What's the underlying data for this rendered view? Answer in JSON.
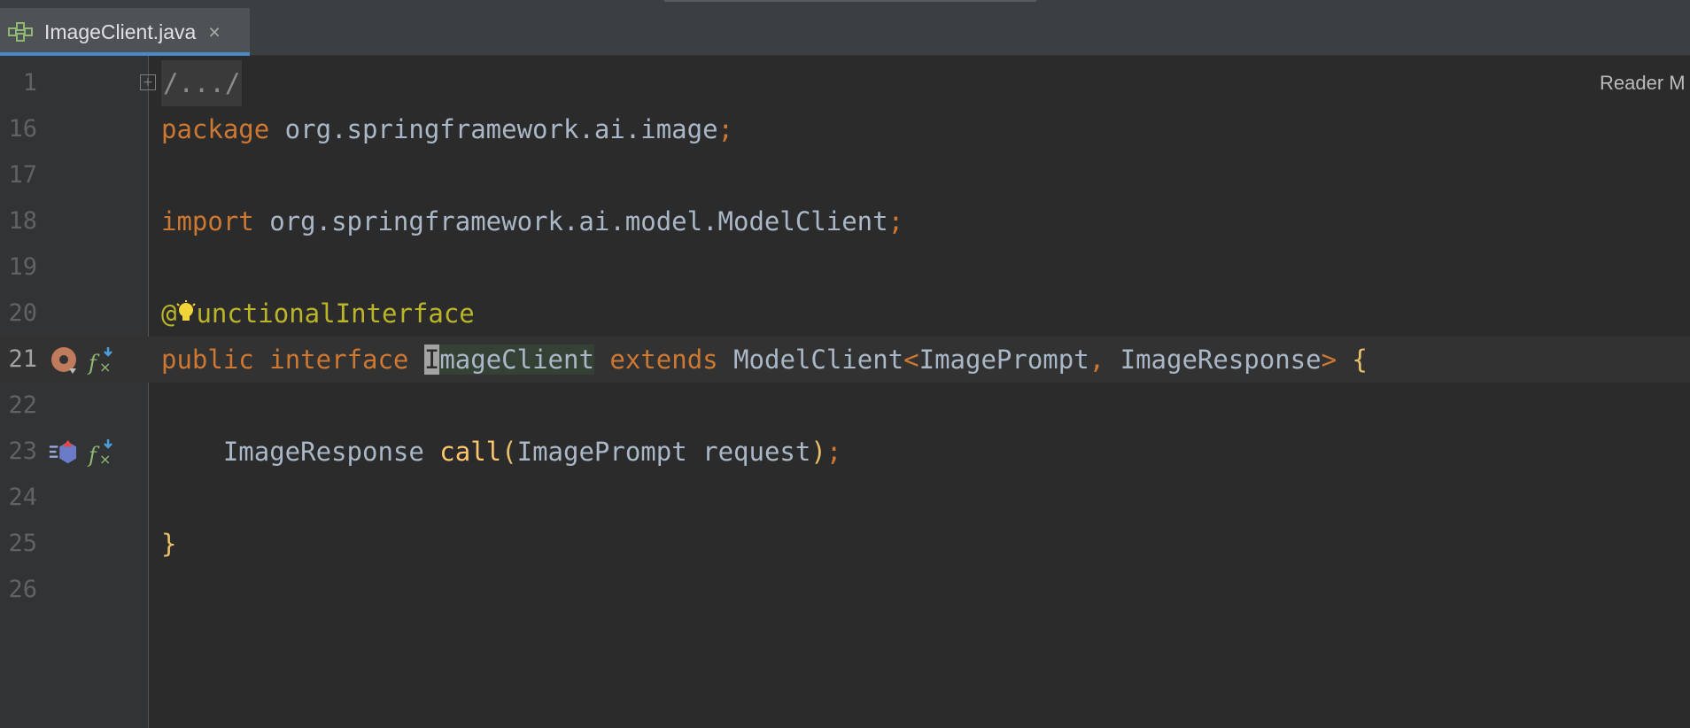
{
  "window": {
    "tab": {
      "label": "ImageClient.java",
      "icon": "interface-file-icon",
      "close": "×"
    }
  },
  "editor": {
    "reader_mode_label": "Reader M",
    "fold": {
      "placeholder": "/.../",
      "expand_icon": "plus-fold-icon",
      "expand_symbol": "+"
    },
    "gutter_icons": {
      "line21": [
        "implemented-icon",
        "function-icon"
      ],
      "line23": [
        "implementations-method-icon",
        "function-icon"
      ]
    },
    "lines": [
      {
        "number": "1"
      },
      {
        "number": "16",
        "kw": "package",
        "rest": " org.springframework.ai.image",
        "semi": ";"
      },
      {
        "number": "17"
      },
      {
        "number": "18",
        "kw": "import",
        "rest": " org.springframework.ai.model.ModelClient",
        "semi": ";"
      },
      {
        "number": "19"
      },
      {
        "number": "20",
        "at": "@",
        "rest": "unctionalInterface",
        "icon": "lightbulb-icon"
      },
      {
        "number": "21",
        "kw1": "public",
        "kw2": "interface",
        "cursor_char": "I",
        "ident_rest": "mageClient",
        "kw3": "extends",
        "type1": "ModelClient",
        "lt": "<",
        "type2": "ImagePrompt",
        "comma": ",",
        "type3": "ImageResponse",
        "gt": ">",
        "brace": "{"
      },
      {
        "number": "22"
      },
      {
        "number": "23",
        "type": "ImageResponse",
        "method": "call",
        "lparen": "(",
        "param_type": "ImagePrompt",
        "param": " request",
        "rparen": ")",
        "semi": ";"
      },
      {
        "number": "24"
      },
      {
        "number": "25",
        "brace": "}"
      },
      {
        "number": "26"
      }
    ]
  },
  "colors": {
    "background": "#2b2b2b",
    "keyword": "#cc7832",
    "annotation": "#bbb529",
    "method": "#ffc66d",
    "text": "#a9b7c6",
    "tab_underline": "#4a88c7"
  }
}
